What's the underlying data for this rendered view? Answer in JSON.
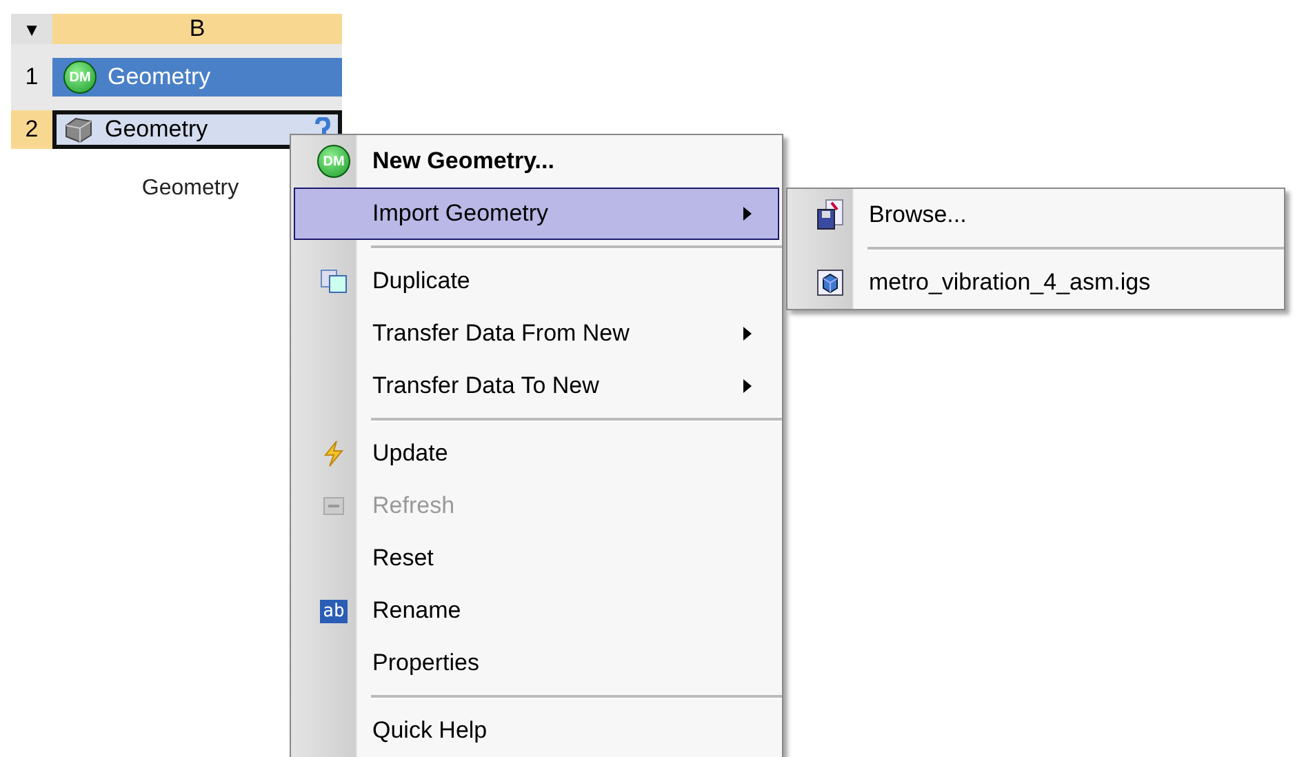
{
  "system": {
    "toggle": "▼",
    "column": "B",
    "rows": [
      {
        "number": "1",
        "label": "Geometry",
        "icon_text": "DM",
        "selected": true
      },
      {
        "number": "2",
        "label": "Geometry",
        "selected": false
      }
    ],
    "caption": "Geometry"
  },
  "context_menu": {
    "items": [
      {
        "kind": "item",
        "label": "New Geometry...",
        "bold": true,
        "icon_text": "DM",
        "submenu": false,
        "selected": false,
        "disabled": false
      },
      {
        "kind": "item",
        "label": "Import Geometry",
        "submenu": true,
        "selected": true,
        "disabled": false
      },
      {
        "kind": "separator"
      },
      {
        "kind": "item",
        "label": "Duplicate",
        "submenu": false,
        "selected": false,
        "disabled": false
      },
      {
        "kind": "item",
        "label": "Transfer Data From New",
        "submenu": true,
        "selected": false,
        "disabled": false
      },
      {
        "kind": "item",
        "label": "Transfer Data To New",
        "submenu": true,
        "selected": false,
        "disabled": false
      },
      {
        "kind": "separator"
      },
      {
        "kind": "item",
        "label": "Update",
        "submenu": false,
        "selected": false,
        "disabled": false
      },
      {
        "kind": "item",
        "label": "Refresh",
        "submenu": false,
        "selected": false,
        "disabled": true
      },
      {
        "kind": "item",
        "label": "Reset",
        "submenu": false,
        "selected": false,
        "disabled": false
      },
      {
        "kind": "item",
        "label": "Rename",
        "icon_text": "ab",
        "submenu": false,
        "selected": false,
        "disabled": false
      },
      {
        "kind": "item",
        "label": "Properties",
        "submenu": false,
        "selected": false,
        "disabled": false
      },
      {
        "kind": "separator"
      },
      {
        "kind": "item",
        "label": "Quick Help",
        "submenu": false,
        "selected": false,
        "disabled": false
      }
    ]
  },
  "submenu": {
    "items": [
      {
        "kind": "item",
        "label": "Browse..."
      },
      {
        "kind": "separator"
      },
      {
        "kind": "item",
        "label": "metro_vibration_4_asm.igs"
      }
    ]
  }
}
